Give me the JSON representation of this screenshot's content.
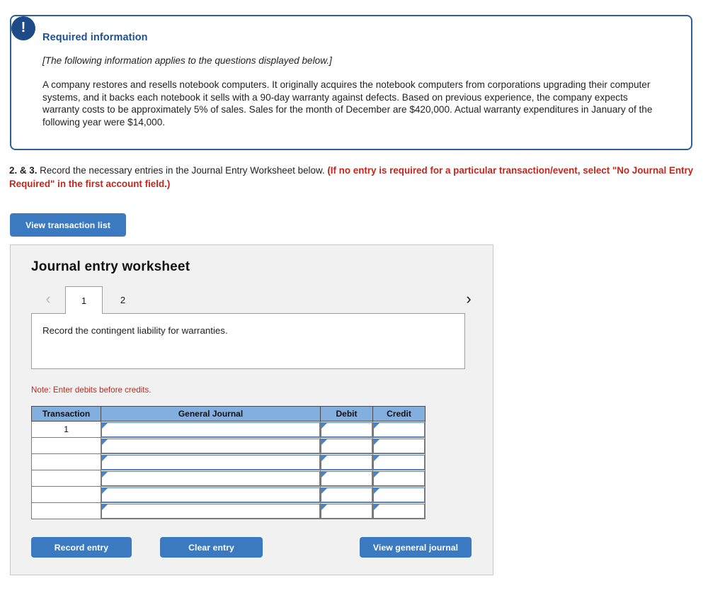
{
  "callout": {
    "icon": "exclamation-icon",
    "heading": "Required information",
    "italic_note": "[The following information applies to the questions displayed below.]",
    "body": "A company restores and resells notebook computers. It originally acquires the notebook computers from corporations upgrading their computer systems, and it backs each notebook it sells with a 90-day warranty against defects. Based on previous experience, the company expects warranty costs to be approximately 5% of sales. Sales for the month of December are $420,000. Actual warranty expenditures in January of the following year were $14,000.",
    "border_color": "#2b5e9e",
    "heading_color": "#1e5191"
  },
  "instruction": {
    "number": "2. & 3.",
    "text": " Record the necessary entries in the Journal Entry Worksheet below. ",
    "requirement": "(If no entry is required for a particular transaction/event, select \"No Journal Entry Required\" in the first account field.)",
    "requirement_color": "#c1271d"
  },
  "toolbar": {
    "view_transaction_list_label": "View transaction list"
  },
  "worksheet": {
    "title": "Journal entry worksheet",
    "prev_arrow": "‹",
    "next_arrow": "›",
    "tabs": [
      {
        "label": "1",
        "active": true
      },
      {
        "label": "2",
        "active": false
      }
    ],
    "prompt": "Record the contingent liability for warranties.",
    "note": "Note: Enter debits before credits.",
    "table": {
      "headers": [
        "Transaction",
        "General Journal",
        "Debit",
        "Credit"
      ],
      "rows": [
        {
          "transaction": "1",
          "general_journal": "",
          "debit": "",
          "credit": ""
        },
        {
          "transaction": "",
          "general_journal": "",
          "debit": "",
          "credit": ""
        },
        {
          "transaction": "",
          "general_journal": "",
          "debit": "",
          "credit": ""
        },
        {
          "transaction": "",
          "general_journal": "",
          "debit": "",
          "credit": ""
        },
        {
          "transaction": "",
          "general_journal": "",
          "debit": "",
          "credit": ""
        },
        {
          "transaction": "",
          "general_journal": "",
          "debit": "",
          "credit": ""
        }
      ],
      "header_bg": "#82aee0"
    },
    "buttons": {
      "record_entry": "Record entry",
      "clear_entry": "Clear entry",
      "view_general_journal": "View general journal"
    },
    "button_color": "#3b7ac0"
  }
}
